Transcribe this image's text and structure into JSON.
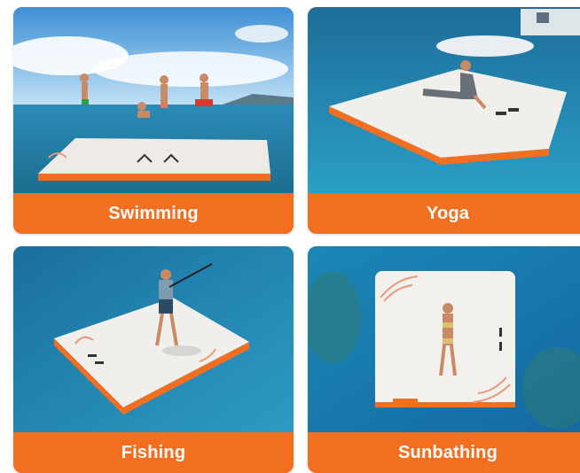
{
  "cards": [
    {
      "label": "Swimming"
    },
    {
      "label": "Yoga"
    },
    {
      "label": "Fishing"
    },
    {
      "label": "Sunbathing"
    }
  ],
  "colors": {
    "accent": "#f26f21",
    "water": "#1f7fb0",
    "sky": "#8cc7ee",
    "platform": "#f1f0ed"
  },
  "icons": [
    "swimming-scene",
    "yoga-scene",
    "fishing-scene",
    "sunbathing-scene"
  ]
}
